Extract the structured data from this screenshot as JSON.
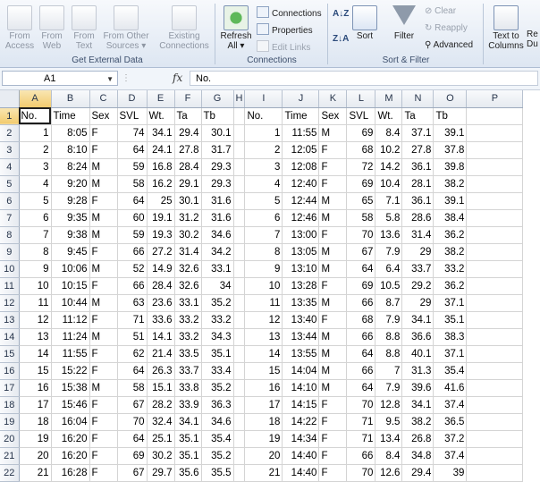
{
  "ribbon": {
    "get_external_data": {
      "buttons": [
        {
          "line1": "From",
          "line2": "Access"
        },
        {
          "line1": "From",
          "line2": "Web"
        },
        {
          "line1": "From",
          "line2": "Text"
        },
        {
          "line1": "From Other",
          "line2": "Sources ▾"
        },
        {
          "line1": "Existing",
          "line2": "Connections"
        }
      ],
      "label": "Get External Data"
    },
    "connections": {
      "refresh_line1": "Refresh",
      "refresh_line2": "All ▾",
      "connections": "Connections",
      "properties": "Properties",
      "edit_links": "Edit Links",
      "label": "Connections"
    },
    "sort_filter": {
      "sort": "Sort",
      "filter": "Filter",
      "clear": "Clear",
      "reapply": "Reapply",
      "advanced": "Advanced",
      "label": "Sort & Filter"
    },
    "data_tools": {
      "text_to_columns_line1": "Text to",
      "text_to_columns_line2": "Columns",
      "remove_dup_partial": "Re",
      "remove_dup_partial2": "Du"
    }
  },
  "formula_bar": {
    "name_box": "A1",
    "fx": "fx",
    "formula": "No."
  },
  "columns": [
    "A",
    "B",
    "C",
    "D",
    "E",
    "F",
    "G",
    "H",
    "I",
    "J",
    "K",
    "L",
    "M",
    "N",
    "O",
    "P"
  ],
  "header_row": [
    "No.",
    "Time",
    "Sex",
    "SVL",
    "Wt.",
    "Ta",
    "Tb",
    "",
    "No.",
    "Time",
    "Sex",
    "SVL",
    "Wt.",
    "Ta",
    "Tb",
    ""
  ],
  "rows": [
    [
      "1",
      "8:05",
      "F",
      "74",
      "34.1",
      "29.4",
      "30.1",
      "",
      "1",
      "11:55",
      "M",
      "69",
      "8.4",
      "37.1",
      "39.1",
      ""
    ],
    [
      "2",
      "8:10",
      "F",
      "64",
      "24.1",
      "27.8",
      "31.7",
      "",
      "2",
      "12:05",
      "F",
      "68",
      "10.2",
      "27.8",
      "37.8",
      ""
    ],
    [
      "3",
      "8:24",
      "M",
      "59",
      "16.8",
      "28.4",
      "29.3",
      "",
      "3",
      "12:08",
      "F",
      "72",
      "14.2",
      "36.1",
      "39.8",
      ""
    ],
    [
      "4",
      "9:20",
      "M",
      "58",
      "16.2",
      "29.1",
      "29.3",
      "",
      "4",
      "12:40",
      "F",
      "69",
      "10.4",
      "28.1",
      "38.2",
      ""
    ],
    [
      "5",
      "9:28",
      "F",
      "64",
      "25",
      "30.1",
      "31.6",
      "",
      "5",
      "12:44",
      "M",
      "65",
      "7.1",
      "36.1",
      "39.1",
      ""
    ],
    [
      "6",
      "9:35",
      "M",
      "60",
      "19.1",
      "31.2",
      "31.6",
      "",
      "6",
      "12:46",
      "M",
      "58",
      "5.8",
      "28.6",
      "38.4",
      ""
    ],
    [
      "7",
      "9:38",
      "M",
      "59",
      "19.3",
      "30.2",
      "34.6",
      "",
      "7",
      "13:00",
      "F",
      "70",
      "13.6",
      "31.4",
      "36.2",
      ""
    ],
    [
      "8",
      "9:45",
      "F",
      "66",
      "27.2",
      "31.4",
      "34.2",
      "",
      "8",
      "13:05",
      "M",
      "67",
      "7.9",
      "29",
      "38.2",
      ""
    ],
    [
      "9",
      "10:06",
      "M",
      "52",
      "14.9",
      "32.6",
      "33.1",
      "",
      "9",
      "13:10",
      "M",
      "64",
      "6.4",
      "33.7",
      "33.2",
      ""
    ],
    [
      "10",
      "10:15",
      "F",
      "66",
      "28.4",
      "32.6",
      "34",
      "",
      "10",
      "13:28",
      "F",
      "69",
      "10.5",
      "29.2",
      "36.2",
      ""
    ],
    [
      "11",
      "10:44",
      "M",
      "63",
      "23.6",
      "33.1",
      "35.2",
      "",
      "11",
      "13:35",
      "M",
      "66",
      "8.7",
      "29",
      "37.1",
      ""
    ],
    [
      "12",
      "11:12",
      "F",
      "71",
      "33.6",
      "33.2",
      "33.2",
      "",
      "12",
      "13:40",
      "F",
      "68",
      "7.9",
      "34.1",
      "35.1",
      ""
    ],
    [
      "13",
      "11:24",
      "M",
      "51",
      "14.1",
      "33.2",
      "34.3",
      "",
      "13",
      "13:44",
      "M",
      "66",
      "8.8",
      "36.6",
      "38.3",
      ""
    ],
    [
      "14",
      "11:55",
      "F",
      "62",
      "21.4",
      "33.5",
      "35.1",
      "",
      "14",
      "13:55",
      "M",
      "64",
      "8.8",
      "40.1",
      "37.1",
      ""
    ],
    [
      "15",
      "15:22",
      "F",
      "64",
      "26.3",
      "33.7",
      "33.4",
      "",
      "15",
      "14:04",
      "M",
      "66",
      "7",
      "31.3",
      "35.4",
      ""
    ],
    [
      "16",
      "15:38",
      "M",
      "58",
      "15.1",
      "33.8",
      "35.2",
      "",
      "16",
      "14:10",
      "M",
      "64",
      "7.9",
      "39.6",
      "41.6",
      ""
    ],
    [
      "17",
      "15:46",
      "F",
      "67",
      "28.2",
      "33.9",
      "36.3",
      "",
      "17",
      "14:15",
      "F",
      "70",
      "12.8",
      "34.1",
      "37.4",
      ""
    ],
    [
      "18",
      "16:04",
      "F",
      "70",
      "32.4",
      "34.1",
      "34.6",
      "",
      "18",
      "14:22",
      "F",
      "71",
      "9.5",
      "38.2",
      "36.5",
      ""
    ],
    [
      "19",
      "16:20",
      "F",
      "64",
      "25.1",
      "35.1",
      "35.4",
      "",
      "19",
      "14:34",
      "F",
      "71",
      "13.4",
      "26.8",
      "37.2",
      ""
    ],
    [
      "20",
      "16:20",
      "F",
      "69",
      "30.2",
      "35.1",
      "35.2",
      "",
      "20",
      "14:40",
      "F",
      "66",
      "8.4",
      "34.8",
      "37.4",
      ""
    ],
    [
      "21",
      "16:28",
      "F",
      "67",
      "29.7",
      "35.6",
      "35.5",
      "",
      "21",
      "14:40",
      "F",
      "70",
      "12.6",
      "29.4",
      "39",
      ""
    ]
  ]
}
